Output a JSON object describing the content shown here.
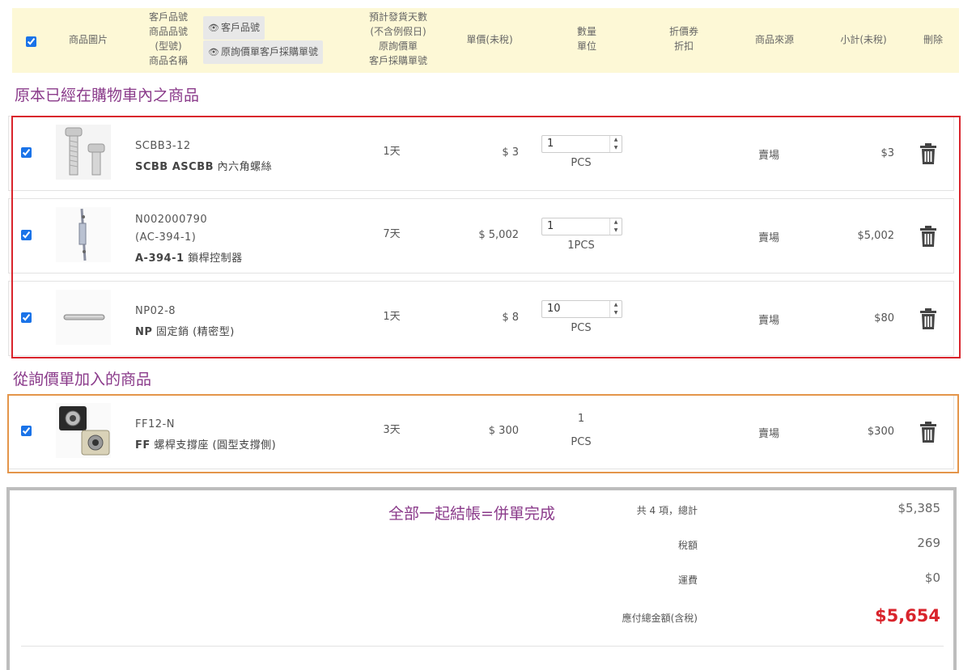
{
  "header": {
    "col_image": "商品圖片",
    "col_part_lines": [
      "客戶品號",
      "商品品號",
      "(型號)",
      "商品名稱"
    ],
    "toggle_customer_part": "客戶品號",
    "toggle_po_number": "原詢價單客戶採購單號",
    "col_ship_lines": [
      "預計發貨天數",
      "(不含例假日)",
      "原詢價單",
      "客戶採購單號"
    ],
    "col_unit_price": "單價(未稅)",
    "col_qty_lines": [
      "數量",
      "單位"
    ],
    "col_coupon_lines": [
      "折價券",
      "折扣"
    ],
    "col_source": "商品來源",
    "col_subtotal": "小計(未稅)",
    "col_delete": "刪除"
  },
  "section_existing": "原本已經在購物車內之商品",
  "section_quote": "從詢價單加入的商品",
  "rows": [
    {
      "code_lines": [
        "SCBB3-12"
      ],
      "name_bold": "SCBB ASCBB",
      "name_rest": " 內六角螺絲",
      "days": "1天",
      "price": "$ 3",
      "qty": "1",
      "unit": "PCS",
      "source": "賣場",
      "subtotal": "$3",
      "has_stepper": true
    },
    {
      "code_lines": [
        "N002000790",
        "(AC-394-1)"
      ],
      "name_bold": "A-394-1",
      "name_rest": " 鎖桿控制器",
      "days": "7天",
      "price": "$ 5,002",
      "qty": "1",
      "unit": "1PCS",
      "source": "賣場",
      "subtotal": "$5,002",
      "has_stepper": true
    },
    {
      "code_lines": [
        "NP02-8"
      ],
      "name_bold": "NP",
      "name_rest": " 固定銷 (精密型)",
      "days": "1天",
      "price": "$ 8",
      "qty": "10",
      "unit": "PCS",
      "source": "賣場",
      "subtotal": "$80",
      "has_stepper": true
    },
    {
      "code_lines": [
        "FF12-N"
      ],
      "name_bold": "FF",
      "name_rest": " 螺桿支撐座 (圓型支撐側)",
      "days": "3天",
      "price": "$ 300",
      "qty": "1",
      "unit": "PCS",
      "source": "賣場",
      "subtotal": "$300",
      "has_stepper": false
    }
  ],
  "totals": {
    "note": "全部一起結帳=併單完成",
    "count_label": "共 4 項，總計",
    "count_value": "$5,385",
    "tax_label": "稅額",
    "tax_value": "269",
    "shipping_label": "運費",
    "shipping_value": "$0",
    "grand_label": "應付總金額(含稅)",
    "grand_value": "$5,654"
  },
  "colors": {
    "accent_red": "#d9242c",
    "accent_orange": "#e4954a",
    "title_purple": "#8a3a8a",
    "header_bg": "#fdf8d6"
  },
  "icons": [
    "eye-icon",
    "trash-icon",
    "spinner-arrows-icon"
  ]
}
